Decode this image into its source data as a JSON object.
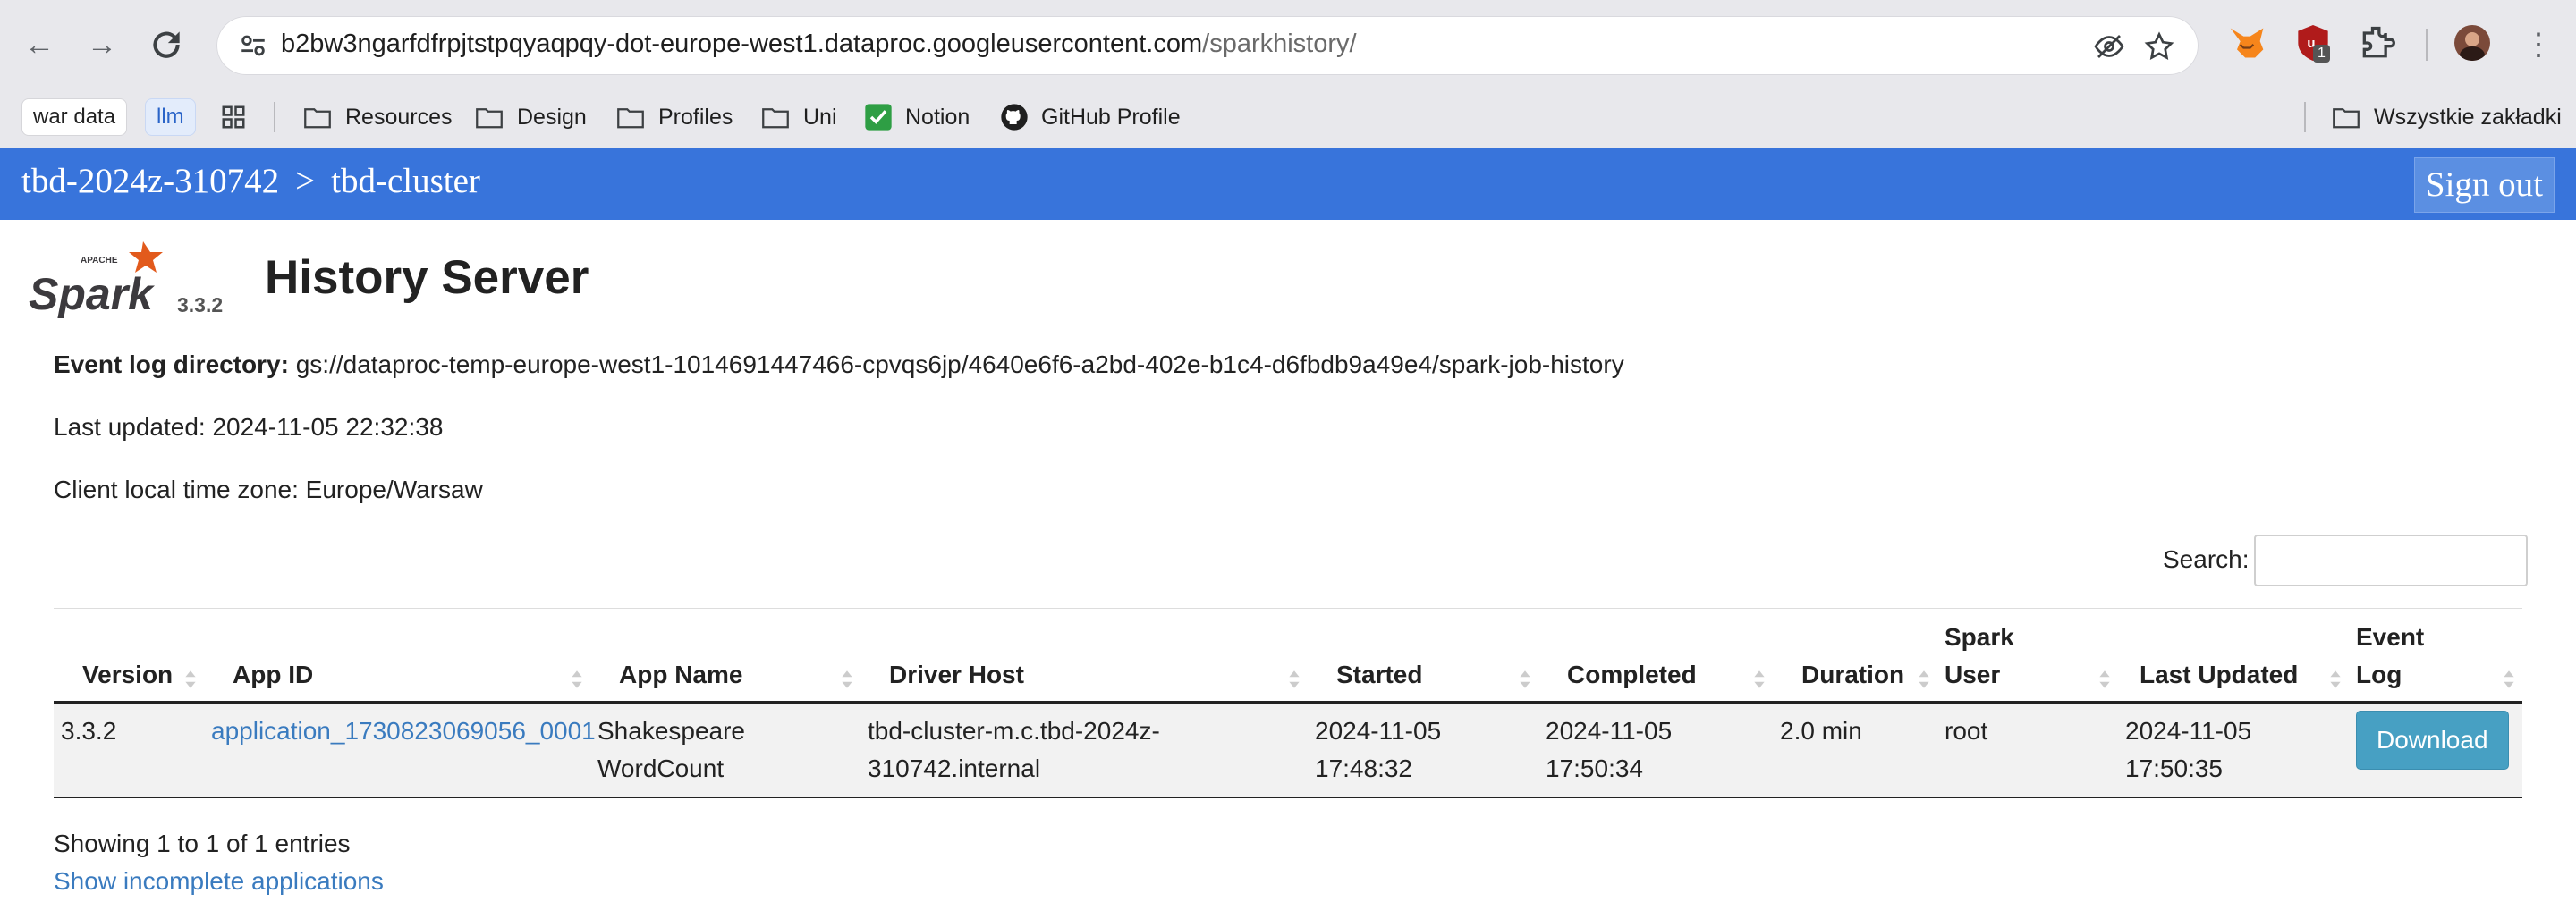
{
  "browser": {
    "url_host": "b2bw3ngarfdfrpjtstpqyaqpqy-dot-europe-west1.dataproc.googleusercontent.com",
    "url_path": "/sparkhistory/",
    "extension_badge": "1",
    "bookmarks": [
      {
        "label": "war data",
        "kind": "chip"
      },
      {
        "label": "llm",
        "kind": "chip-blue"
      },
      {
        "label": "",
        "kind": "apps"
      },
      {
        "label": "Resources",
        "kind": "folder"
      },
      {
        "label": "Design",
        "kind": "folder"
      },
      {
        "label": "Profiles",
        "kind": "folder"
      },
      {
        "label": "Uni",
        "kind": "folder"
      },
      {
        "label": "Notion",
        "kind": "check"
      },
      {
        "label": "GitHub Profile",
        "kind": "github"
      }
    ],
    "all_bookmarks_label": "Wszystkie zakładki"
  },
  "topbar": {
    "project": "tbd-2024z-310742",
    "separator": ">",
    "cluster": "tbd-cluster",
    "sign_out": "Sign out",
    "color": "#3874db"
  },
  "header": {
    "logo_top": "APACHE",
    "logo_text": "Spark",
    "version": "3.3.2",
    "title": "History Server"
  },
  "info": {
    "event_log_label": "Event log directory:",
    "event_log_value": "gs://dataproc-temp-europe-west1-1014691447466-cpvqs6jp/4640e6f6-a2bd-402e-b1c4-d6fbdb9a49e4/spark-job-history",
    "last_updated": "Last updated: 2024-11-05 22:32:38",
    "timezone": "Client local time zone: Europe/Warsaw"
  },
  "search": {
    "label": "Search:",
    "value": ""
  },
  "table": {
    "columns": [
      "Version",
      "App ID",
      "App Name",
      "Driver Host",
      "Started",
      "Completed",
      "Duration",
      "Spark User",
      "Last Updated",
      "Event Log"
    ],
    "rows": [
      {
        "version": "3.3.2",
        "app_id": "application_1730823069056_0001",
        "app_name": "Shakespeare WordCount",
        "driver_host": "tbd-cluster-m.c.tbd-2024z-310742.internal",
        "started": "2024-11-05 17:48:32",
        "completed": "2024-11-05 17:50:34",
        "duration": "2.0 min",
        "spark_user": "root",
        "last_updated": "2024-11-05 17:50:35",
        "event_log": "Download"
      }
    ]
  },
  "footer": {
    "showing": "Showing 1 to 1 of 1 entries",
    "incomplete_link": "Show incomplete applications"
  }
}
